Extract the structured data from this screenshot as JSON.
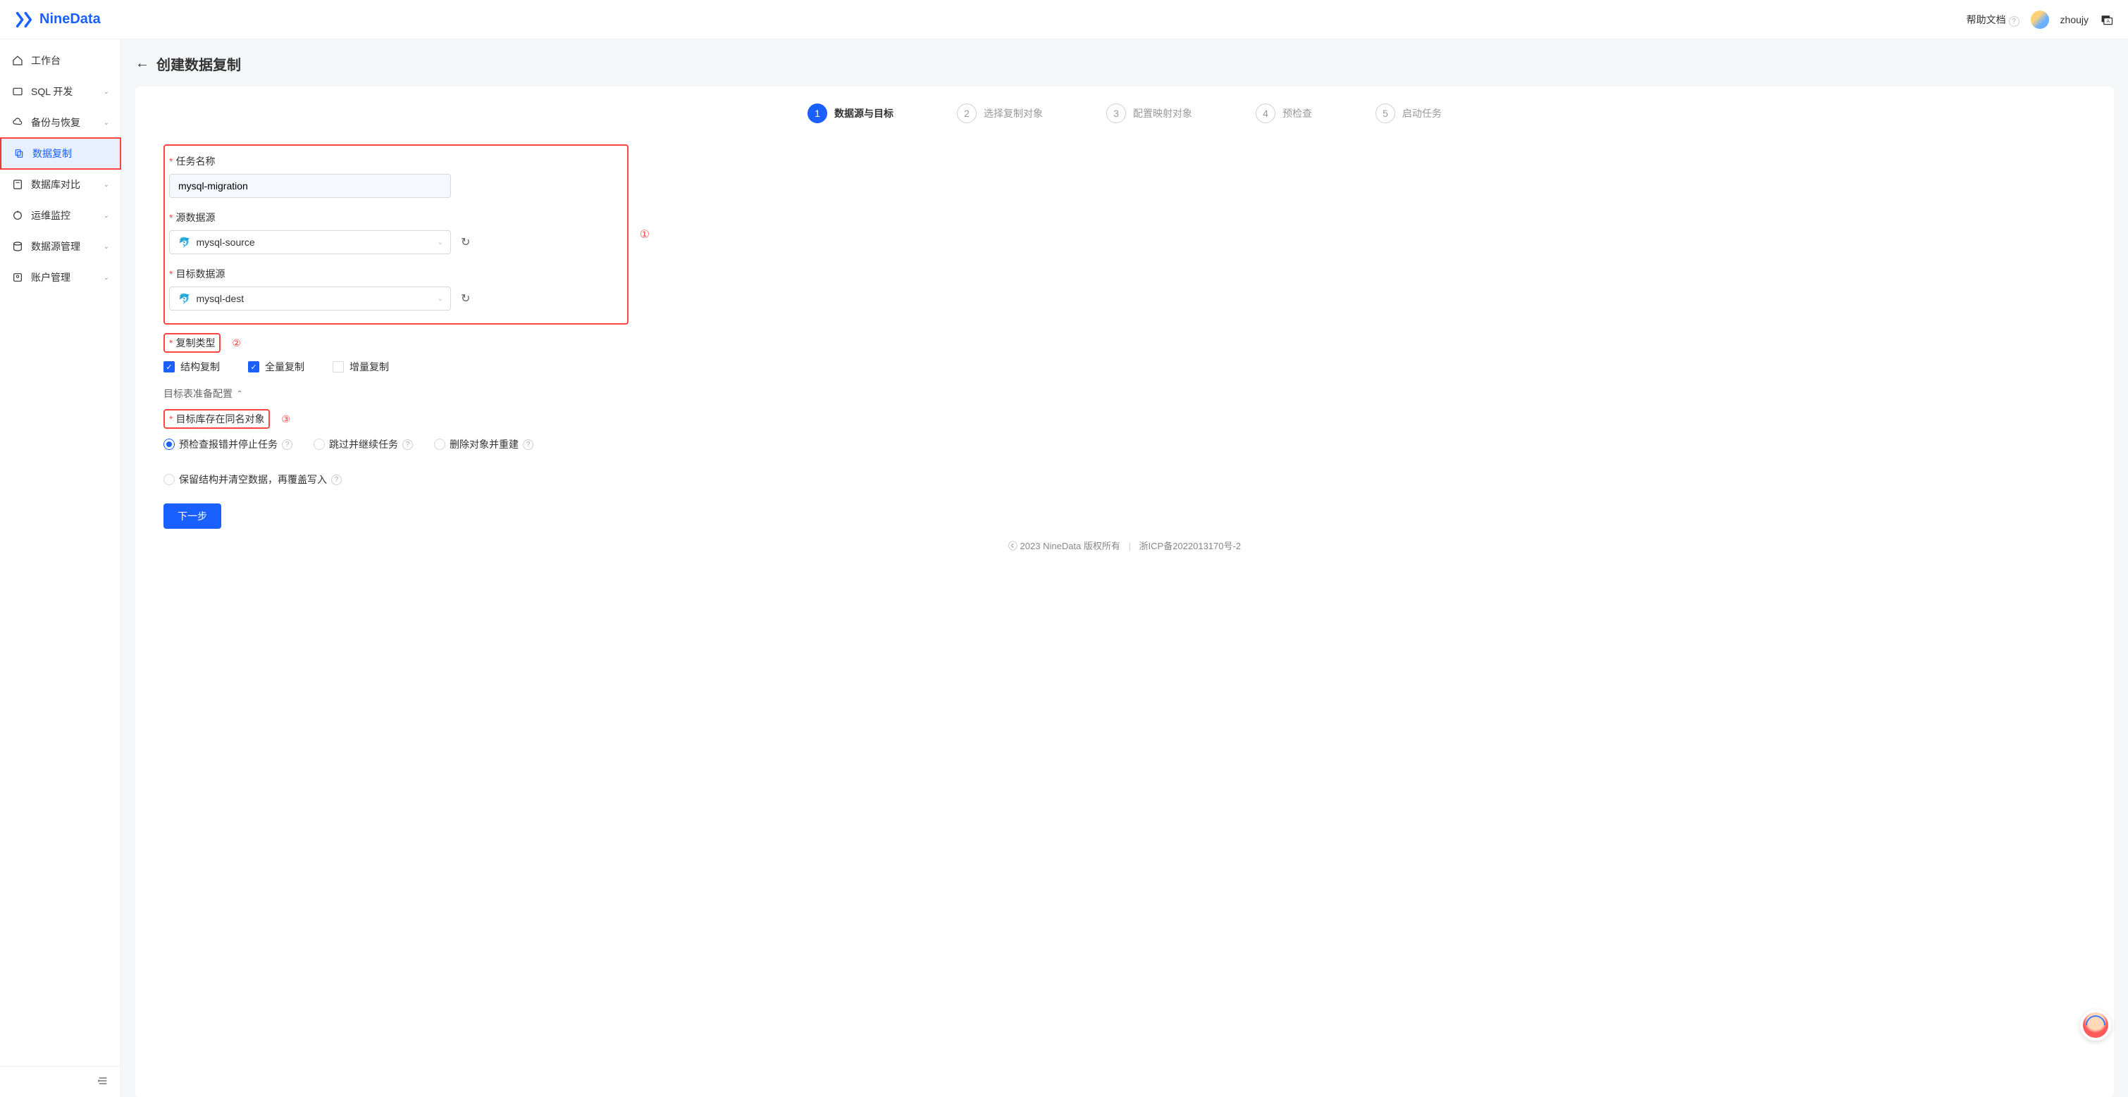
{
  "brand": "NineData",
  "header": {
    "help_link": "帮助文档",
    "username": "zhoujy"
  },
  "sidebar": {
    "items": [
      {
        "label": "工作台",
        "icon": "home",
        "expandable": false
      },
      {
        "label": "SQL 开发",
        "icon": "code",
        "expandable": true
      },
      {
        "label": "备份与恢复",
        "icon": "cloud",
        "expandable": true
      },
      {
        "label": "数据复制",
        "icon": "copy",
        "expandable": false,
        "active": true
      },
      {
        "label": "数据库对比",
        "icon": "compare",
        "expandable": true
      },
      {
        "label": "运维监控",
        "icon": "monitor",
        "expandable": true
      },
      {
        "label": "数据源管理",
        "icon": "db",
        "expandable": true
      },
      {
        "label": "账户管理",
        "icon": "account",
        "expandable": true
      }
    ]
  },
  "page": {
    "title": "创建数据复制"
  },
  "steps": [
    {
      "num": "1",
      "label": "数据源与目标",
      "active": true
    },
    {
      "num": "2",
      "label": "选择复制对象",
      "active": false
    },
    {
      "num": "3",
      "label": "配置映射对象",
      "active": false
    },
    {
      "num": "4",
      "label": "预检查",
      "active": false
    },
    {
      "num": "5",
      "label": "启动任务",
      "active": false
    }
  ],
  "form": {
    "task_name_label": "任务名称",
    "task_name_value": "mysql-migration",
    "source_label": "源数据源",
    "source_value": "mysql-source",
    "dest_label": "目标数据源",
    "dest_value": "mysql-dest",
    "replicate_type_label": "复制类型",
    "replicate_options": [
      {
        "label": "结构复制",
        "checked": true
      },
      {
        "label": "全量复制",
        "checked": true
      },
      {
        "label": "增量复制",
        "checked": false
      }
    ],
    "collapse_label": "目标表准备配置",
    "conflict_label": "目标库存在同名对象",
    "conflict_options": [
      {
        "label": "预检查报错并停止任务",
        "checked": true
      },
      {
        "label": "跳过并继续任务",
        "checked": false
      },
      {
        "label": "删除对象并重建",
        "checked": false
      },
      {
        "label": "保留结构并清空数据，再覆盖写入",
        "checked": false
      }
    ],
    "next_button": "下一步"
  },
  "annotations": {
    "a1": "①",
    "a2": "②",
    "a3": "③"
  },
  "footer": {
    "copyright": "2023 NineData 版权所有",
    "icp": "浙ICP备2022013170号-2"
  }
}
